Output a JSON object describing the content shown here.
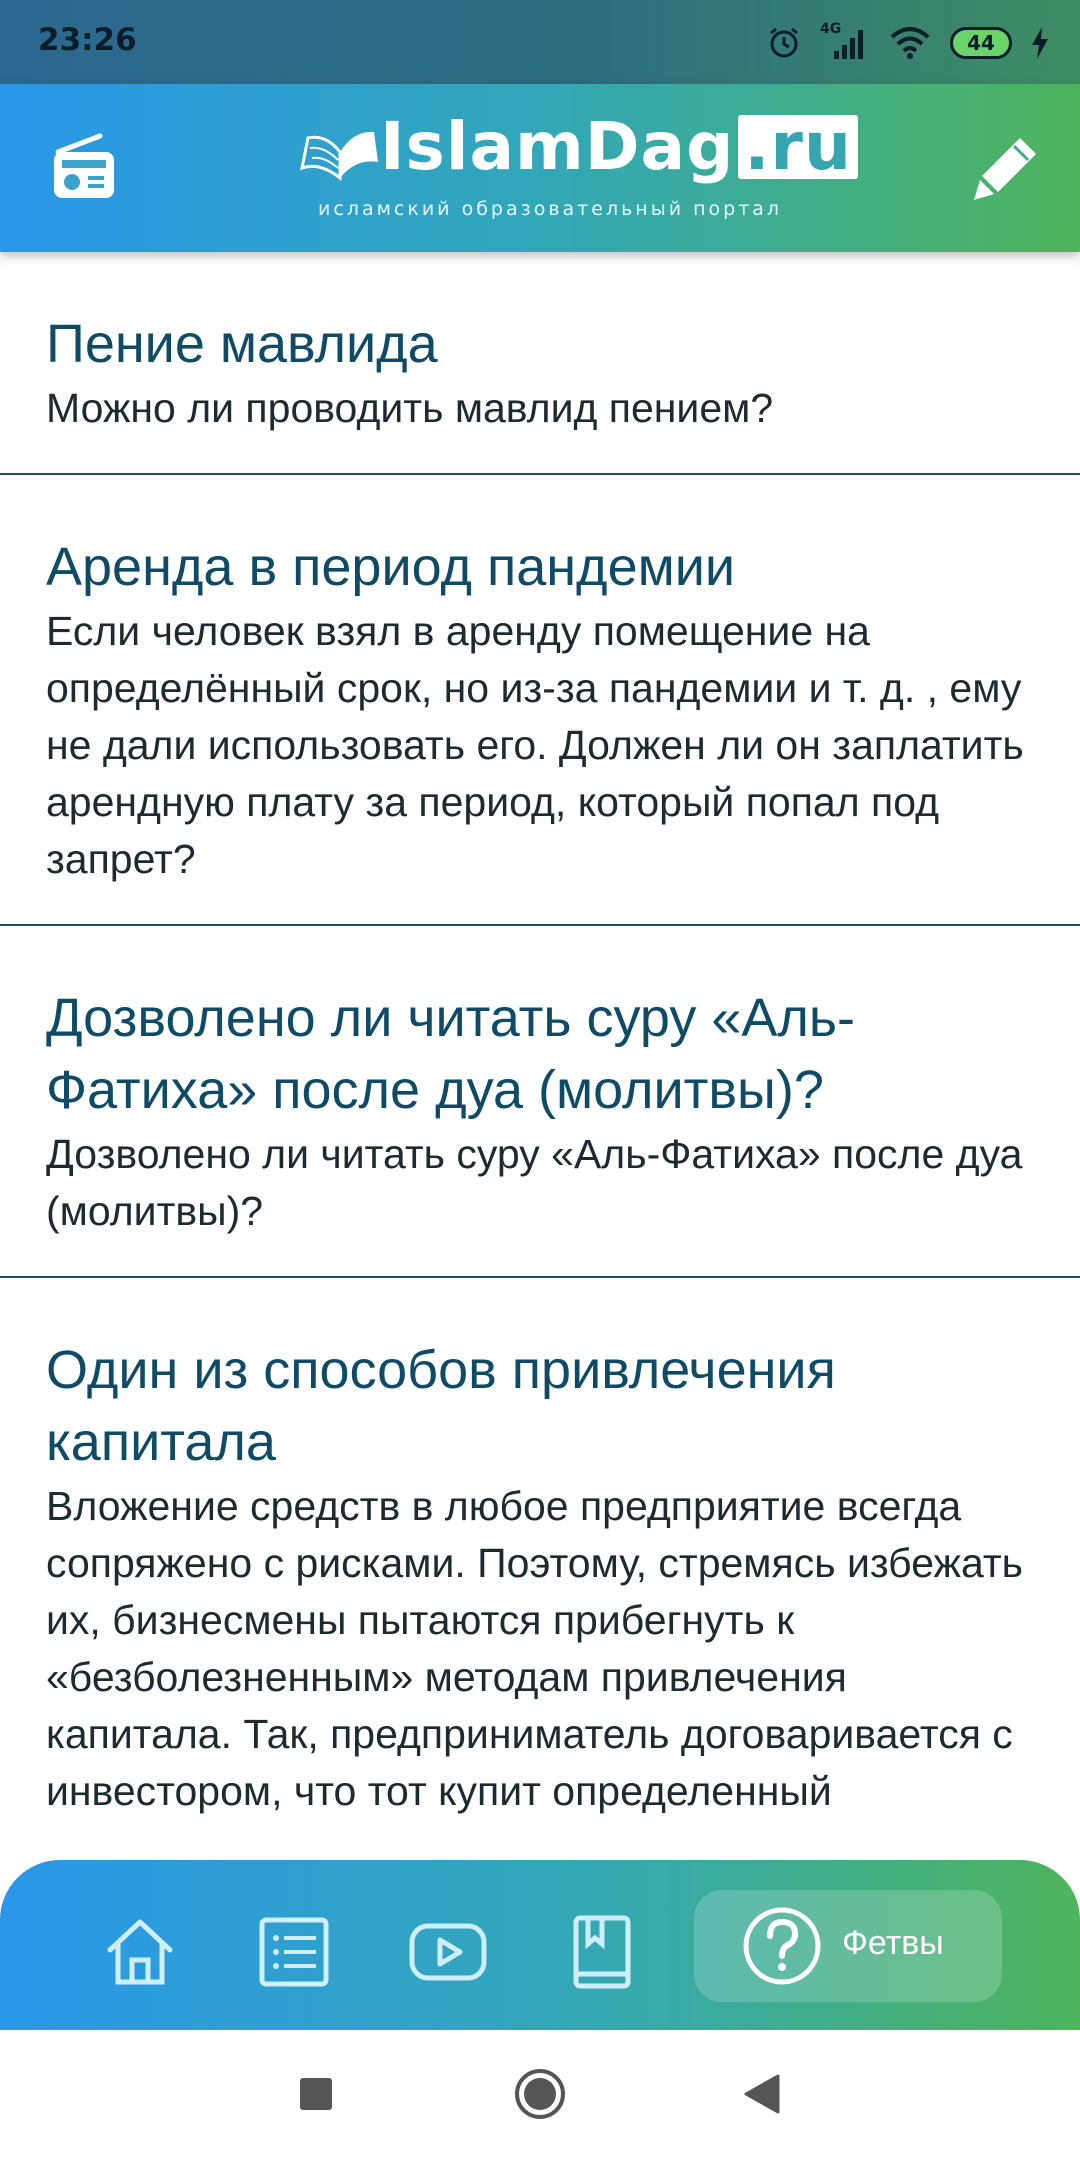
{
  "status_bar": {
    "time": "23:26",
    "network": "4G",
    "battery": "44",
    "icons": [
      "alarm-icon",
      "signal-icon",
      "wifi-icon",
      "battery-icon",
      "charging-icon"
    ]
  },
  "header": {
    "logo_text": "IslamDag",
    "logo_ru": ".ru",
    "logo_subtitle": "исламский образовательный портал",
    "left_icon": "radio-icon",
    "right_icon": "pencil-icon"
  },
  "articles": [
    {
      "title": "Пение мавлида",
      "text": "Можно ли проводить мавлид пением?"
    },
    {
      "title": "Аренда в период пандемии",
      "text": "Если человек взял в аренду помещение на определённый срок, но из-за пандемии и т. д. , ему не дали использовать его.  Должен ли он заплатить арендную плату за период, который попал под запрет?"
    },
    {
      "title": "Дозволено ли читать суру «Аль-Фатиха» после дуа (молитвы)?",
      "text": "Дозволено ли читать суру «Аль-Фатиха» после дуа (молитвы)?"
    },
    {
      "title": "Один из способов привлечения капитала",
      "text": "Вложение средств в любое предприятие всегда сопряжено с рисками. Поэтому, стремясь избежать их, бизнесмены пытаются прибегнуть к «безболезненным» методам привлечения капитала. Так, предприниматель договаривается с инвестором, что тот купит определенный"
    }
  ],
  "bottom_nav": {
    "items": [
      "home-icon",
      "list-icon",
      "video-icon",
      "book-icon",
      "question-icon"
    ],
    "active_label": "Фетвы"
  },
  "system_nav": [
    "recents-button",
    "home-button",
    "back-button"
  ],
  "colors": {
    "title": "#0f4a66",
    "text": "#1d2a30",
    "gradient_start": "#2a97ea",
    "gradient_end": "#4fb35c"
  }
}
